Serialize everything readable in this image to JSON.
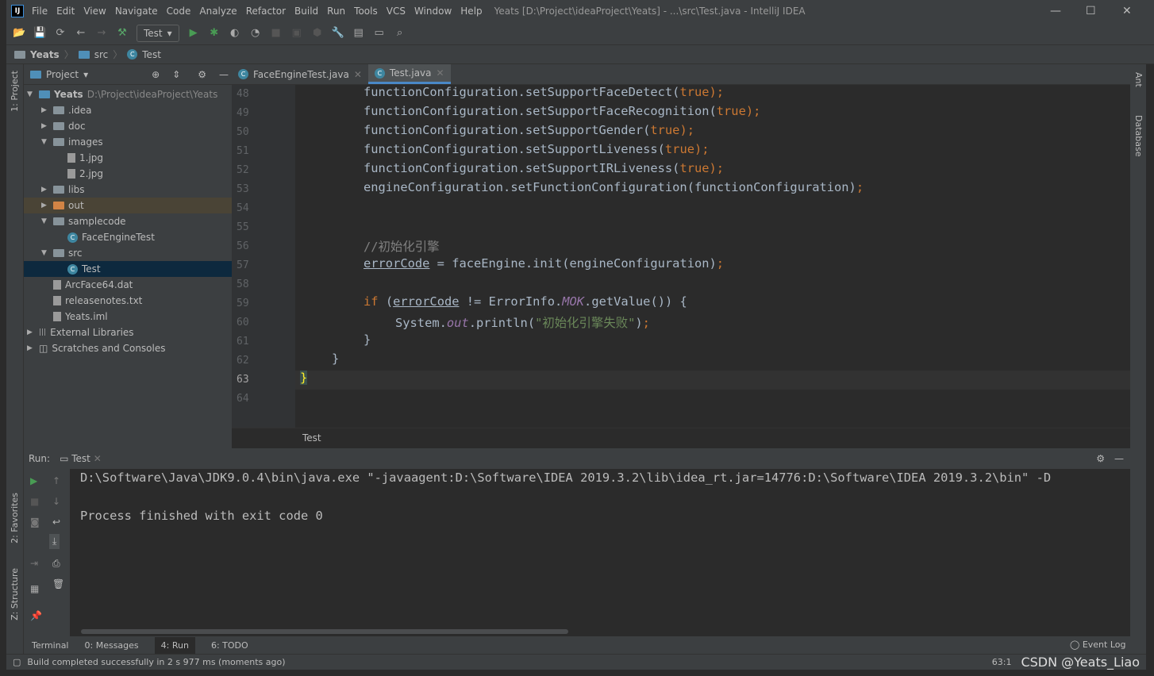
{
  "title": {
    "menu": [
      "File",
      "Edit",
      "View",
      "Navigate",
      "Code",
      "Analyze",
      "Refactor",
      "Build",
      "Run",
      "Tools",
      "VCS",
      "Window",
      "Help"
    ],
    "text": "Yeats [D:\\Project\\ideaProject\\Yeats] - ...\\src\\Test.java - IntelliJ IDEA",
    "logo": "IJ"
  },
  "toolbar": {
    "run_config": "Test"
  },
  "breadcrumb": [
    "Yeats",
    "src",
    "Test"
  ],
  "left_stripe": {
    "project": "1: Project",
    "favorites": "2: Favorites",
    "structure": "Z: Structure"
  },
  "right_stripe": {
    "ant": "Ant",
    "database": "Database"
  },
  "project": {
    "header": "Project",
    "tree": [
      {
        "label": "Yeats",
        "path": "D:\\Project\\ideaProject\\Yeats",
        "depth": 0,
        "open": true,
        "type": "module"
      },
      {
        "label": ".idea",
        "depth": 1,
        "open": false,
        "type": "folder"
      },
      {
        "label": "doc",
        "depth": 1,
        "open": false,
        "type": "folder"
      },
      {
        "label": "images",
        "depth": 1,
        "open": true,
        "type": "folder"
      },
      {
        "label": "1.jpg",
        "depth": 2,
        "type": "file"
      },
      {
        "label": "2.jpg",
        "depth": 2,
        "type": "file"
      },
      {
        "label": "libs",
        "depth": 1,
        "open": false,
        "type": "folder"
      },
      {
        "label": "out",
        "depth": 1,
        "open": false,
        "type": "folder-out"
      },
      {
        "label": "samplecode",
        "depth": 1,
        "open": true,
        "type": "folder"
      },
      {
        "label": "FaceEngineTest",
        "depth": 2,
        "type": "class"
      },
      {
        "label": "src",
        "depth": 1,
        "open": true,
        "type": "folder"
      },
      {
        "label": "Test",
        "depth": 2,
        "type": "class",
        "selected": true
      },
      {
        "label": "ArcFace64.dat",
        "depth": 1,
        "type": "file"
      },
      {
        "label": "releasenotes.txt",
        "depth": 1,
        "type": "file"
      },
      {
        "label": "Yeats.iml",
        "depth": 1,
        "type": "file"
      },
      {
        "label": "External Libraries",
        "depth": 0,
        "open": false,
        "type": "lib"
      },
      {
        "label": "Scratches and Consoles",
        "depth": 0,
        "open": false,
        "type": "scratch"
      }
    ]
  },
  "editor": {
    "tabs": [
      {
        "label": "FaceEngineTest.java",
        "active": false
      },
      {
        "label": "Test.java",
        "active": true
      }
    ],
    "line_numbers": [
      "48",
      "49",
      "50",
      "51",
      "52",
      "53",
      "54",
      "55",
      "56",
      "57",
      "58",
      "59",
      "60",
      "61",
      "62",
      "63",
      "64"
    ],
    "breadcrumb": "Test"
  },
  "run": {
    "label": "Run:",
    "tab": "Test",
    "lines": [
      "D:\\Software\\Java\\JDK9.0.4\\bin\\java.exe \"-javaagent:D:\\Software\\IDEA 2019.3.2\\lib\\idea_rt.jar=14776:D:\\Software\\IDEA 2019.3.2\\bin\" -D",
      "",
      "Process finished with exit code 0"
    ]
  },
  "bottom_tabs": [
    "Terminal",
    "0: Messages",
    "4: Run",
    "6: TODO"
  ],
  "event_log": "Event Log",
  "status": {
    "message": "Build completed successfully in 2 s 977 ms (moments ago)",
    "position": "63:1",
    "watermark": "CSDN @Yeats_Liao"
  }
}
